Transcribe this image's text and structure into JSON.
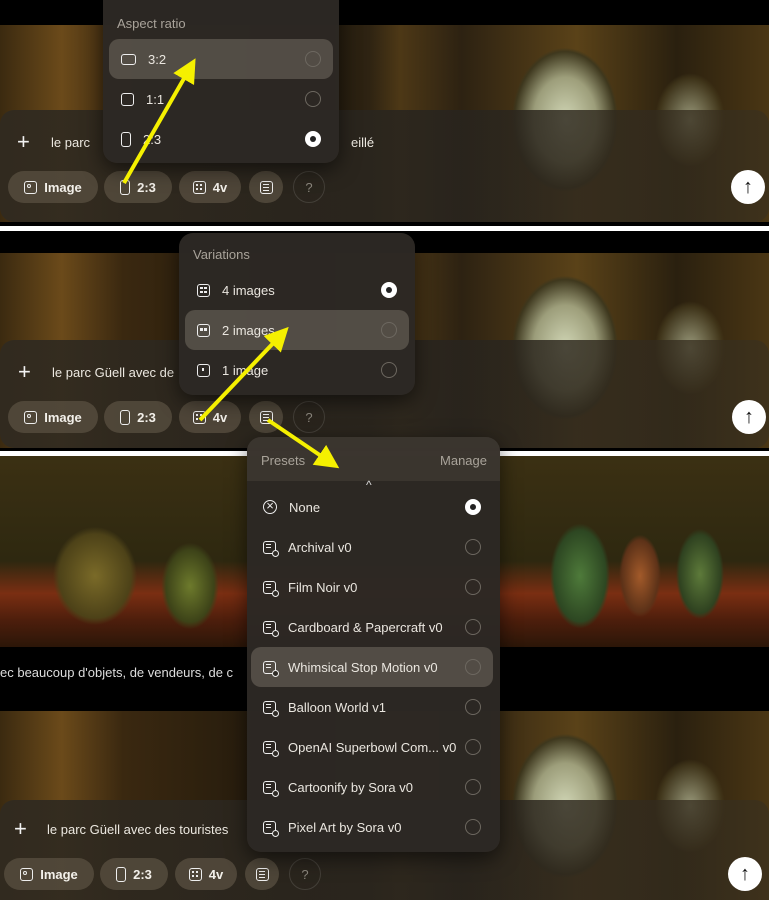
{
  "panel1": {
    "prompt_start": "le parc",
    "prompt_end": "eillé",
    "chips": {
      "image": "Image",
      "ratio": "2:3",
      "variations": "4v",
      "help": "?"
    },
    "menu": {
      "title": "Aspect ratio",
      "items": [
        {
          "label": "3:2",
          "icon": "landscape-ratio-icon",
          "selected": false
        },
        {
          "label": "1:1",
          "icon": "square-ratio-icon",
          "selected": false
        },
        {
          "label": "2:3",
          "icon": "portrait-ratio-icon",
          "selected": true
        }
      ]
    }
  },
  "panel2": {
    "prompt": "le parc  Güell avec de",
    "chips": {
      "image": "Image",
      "ratio": "2:3",
      "variations": "4v",
      "help": "?"
    },
    "menu": {
      "title": "Variations",
      "items": [
        {
          "label": "4 images",
          "icon": "grid-four-icon",
          "selected": true
        },
        {
          "label": "2 images",
          "icon": "grid-two-icon",
          "selected": false
        },
        {
          "label": "1 image",
          "icon": "grid-one-icon",
          "selected": false
        }
      ]
    }
  },
  "panel3": {
    "caption": "ec beaucoup d'objets, de vendeurs, de c"
  },
  "panel4": {
    "prompt": "le parc  Güell avec des touristes",
    "chips": {
      "image": "Image",
      "ratio": "2:3",
      "variations": "4v",
      "help": "?"
    }
  },
  "presets_menu": {
    "title": "Presets",
    "manage": "Manage",
    "items": [
      {
        "label": "None",
        "icon": "none-circle-icon",
        "selected": true
      },
      {
        "label": "Archival v0",
        "icon": "preset-icon",
        "selected": false
      },
      {
        "label": "Film Noir v0",
        "icon": "preset-icon",
        "selected": false
      },
      {
        "label": "Cardboard & Papercraft v0",
        "icon": "preset-icon",
        "selected": false
      },
      {
        "label": "Whimsical Stop Motion v0",
        "icon": "preset-icon",
        "selected": false
      },
      {
        "label": "Balloon World v1",
        "icon": "preset-icon",
        "selected": false
      },
      {
        "label": "OpenAI Superbowl Com... v0",
        "icon": "preset-icon",
        "selected": false
      },
      {
        "label": "Cartoonify by Sora v0",
        "icon": "preset-icon",
        "selected": false
      },
      {
        "label": "Pixel Art by Sora v0",
        "icon": "preset-icon",
        "selected": false
      }
    ]
  },
  "colors": {
    "arrow": "#f5f000",
    "background": "#000000",
    "menu": "#2c2824"
  }
}
